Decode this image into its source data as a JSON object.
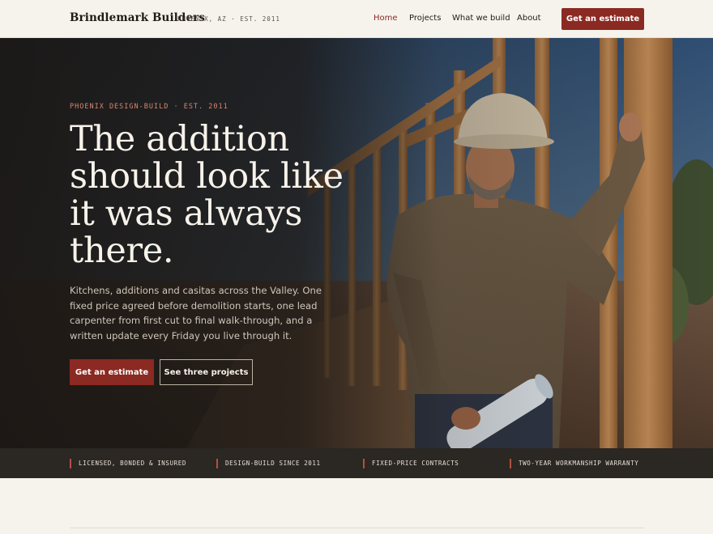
{
  "header": {
    "brand": "Brindlemark Builders",
    "brand_meta": "PHOENIX, AZ · EST. 2011",
    "nav": [
      {
        "label": "Home",
        "active": true
      },
      {
        "label": "Projects",
        "active": false
      },
      {
        "label": "What we build",
        "active": false
      },
      {
        "label": "About",
        "active": false
      }
    ],
    "cta": "Get an estimate"
  },
  "hero": {
    "eyebrow": "PHOENIX DESIGN-BUILD · EST. 2011",
    "headline_lines": [
      "The addition",
      "should look like",
      "it was always",
      "there."
    ],
    "lede": "Kitchens, additions and casitas across the Valley. One fixed price agreed before demolition starts, one lead carpenter from first cut to final walk-through, and a written update every Friday you live through it.",
    "primary_button": "Get an estimate",
    "secondary_button": "See three projects"
  },
  "trust": [
    "LICENSED, BONDED & INSURED",
    "DESIGN-BUILD SINCE 2011",
    "FIXED-PRICE CONTRACTS",
    "TWO-YEAR WORKMANSHIP WARRANTY"
  ],
  "colors": {
    "accent": "#8b2a22",
    "background": "#f6f3ed",
    "hero_text": "#f7f2ea",
    "trust_bar": "#2b2723"
  }
}
